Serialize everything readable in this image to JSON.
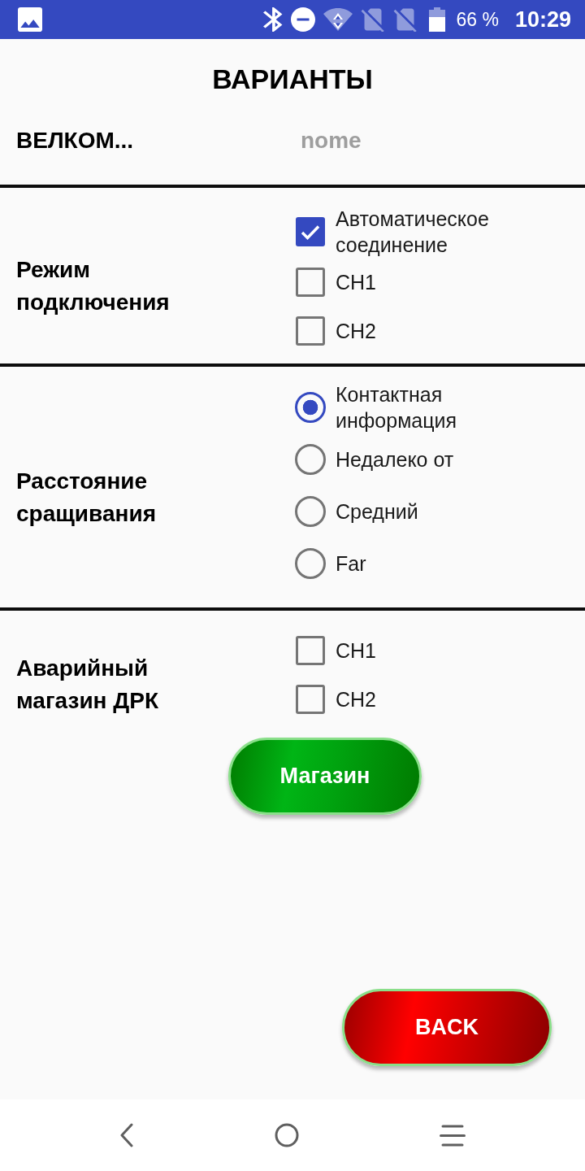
{
  "status_bar": {
    "battery": "66 %",
    "time": "10:29"
  },
  "title": "ВАРИАНТЫ",
  "device": {
    "name": "ВЕЛКОМ...",
    "value": "nome"
  },
  "sections": [
    {
      "label": "Режим подключения",
      "kind": "checkbox",
      "options": [
        {
          "label": "Автоматическое соединение",
          "checked": true
        },
        {
          "label": "CH1",
          "checked": false
        },
        {
          "label": "CH2",
          "checked": false
        }
      ]
    },
    {
      "label": "Расстояние сращивания",
      "kind": "radio",
      "options": [
        {
          "label": "Контактная информация",
          "selected": true
        },
        {
          "label": "Недалеко от",
          "selected": false
        },
        {
          "label": "Средний",
          "selected": false
        },
        {
          "label": "Far",
          "selected": false
        }
      ]
    },
    {
      "label": "Аварийный магазин ДРК",
      "kind": "checkbox",
      "options": [
        {
          "label": "CH1",
          "checked": false
        },
        {
          "label": "CH2",
          "checked": false
        }
      ],
      "button": "Магазин"
    }
  ],
  "back_button": "BACK"
}
